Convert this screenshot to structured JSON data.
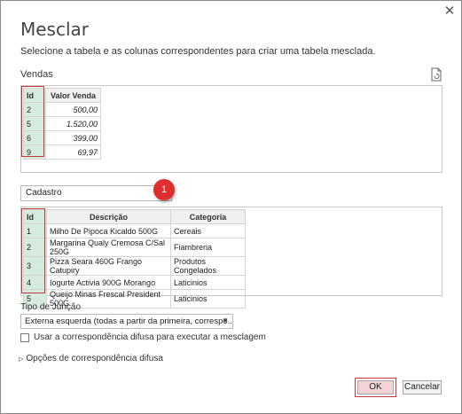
{
  "dialog": {
    "title": "Mesclar",
    "subtitle": "Selecione a tabela e as colunas correspondentes para criar uma tabela mesclada."
  },
  "table1": {
    "name": "Vendas",
    "headers": [
      "Id",
      "Valor Venda"
    ],
    "rows": [
      [
        "2",
        "500,00"
      ],
      [
        "5",
        "1.520,00"
      ],
      [
        "6",
        "399,00"
      ],
      [
        "9",
        "69,97"
      ]
    ]
  },
  "table2": {
    "name": "Cadastro",
    "headers": [
      "Id",
      "Descrição",
      "Categoria"
    ],
    "rows": [
      [
        "1",
        "Milho De Pipoca Kicaldo 500G",
        "Cereais"
      ],
      [
        "2",
        "Margarina Qualy Cremosa C/Sal 250G",
        "Fiambreria"
      ],
      [
        "3",
        "Pizza Seara 460G Frango Catupiry",
        "Produtos Congelados"
      ],
      [
        "4",
        "Iogurte Activia 900G Morango",
        "Laticinios"
      ],
      [
        "5",
        "Queijo Minas Frescal President 500G",
        "Laticinios"
      ]
    ]
  },
  "badge": "1",
  "join": {
    "label": "Tipo de Junção",
    "value": "Externa esquerda (todas a partir da primeira, correspo..."
  },
  "fuzzy": {
    "checkbox_label": "Usar a correspondência difusa para executar a mesclagem",
    "options_label": "Opções de correspondência difusa"
  },
  "buttons": {
    "ok": "OK",
    "cancel": "Cancelar"
  },
  "colors": {
    "highlight": "#c0393b",
    "id_column": "#d6eadd",
    "badge": "#e02d2d"
  }
}
